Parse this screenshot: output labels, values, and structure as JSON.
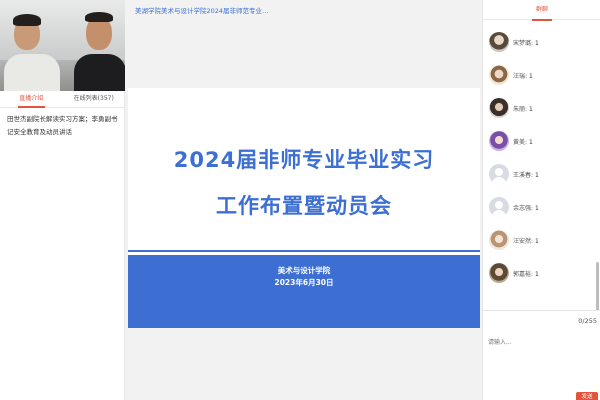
{
  "left_panel": {
    "tabs": [
      {
        "label": "直播介绍",
        "active": true
      },
      {
        "label": "在线列表(357)",
        "active": false
      }
    ],
    "intro_text": "田世杰副院长解读实习方案；李勇副书记安全教育及动员讲话"
  },
  "center": {
    "title": "美湖学院美术与设计学院2024届非师范专业…",
    "slide": {
      "title_line1": "2024届非师专业毕业实习",
      "title_line2": "工作布置暨动员会",
      "organization": "美术与设计学院",
      "date": "2023年6月30日"
    }
  },
  "right_panel": {
    "tab_label": "群聊",
    "members": [
      {
        "name": "宋梦璐",
        "count": "1",
        "avatar": "photo-avatar"
      },
      {
        "name": "汪瑞",
        "count": "1",
        "avatar": "photo-avatar"
      },
      {
        "name": "朱丽",
        "count": "1",
        "avatar": "photo-avatar"
      },
      {
        "name": "黄美",
        "count": "1",
        "avatar": "photo-avatar"
      },
      {
        "name": "王溪春",
        "count": "1",
        "avatar": "default-user-icon"
      },
      {
        "name": "余志强",
        "count": "1",
        "avatar": "default-user-icon"
      },
      {
        "name": "汪安然",
        "count": "1",
        "avatar": "photo-avatar"
      },
      {
        "name": "郭嘉裕",
        "count": "1",
        "avatar": "photo-avatar"
      }
    ],
    "char_counter": "0/255",
    "input_placeholder": "请输入...",
    "send_label": "发送"
  },
  "colors": {
    "accent": "#e2543d",
    "slide_blue": "#3d6fd3"
  }
}
